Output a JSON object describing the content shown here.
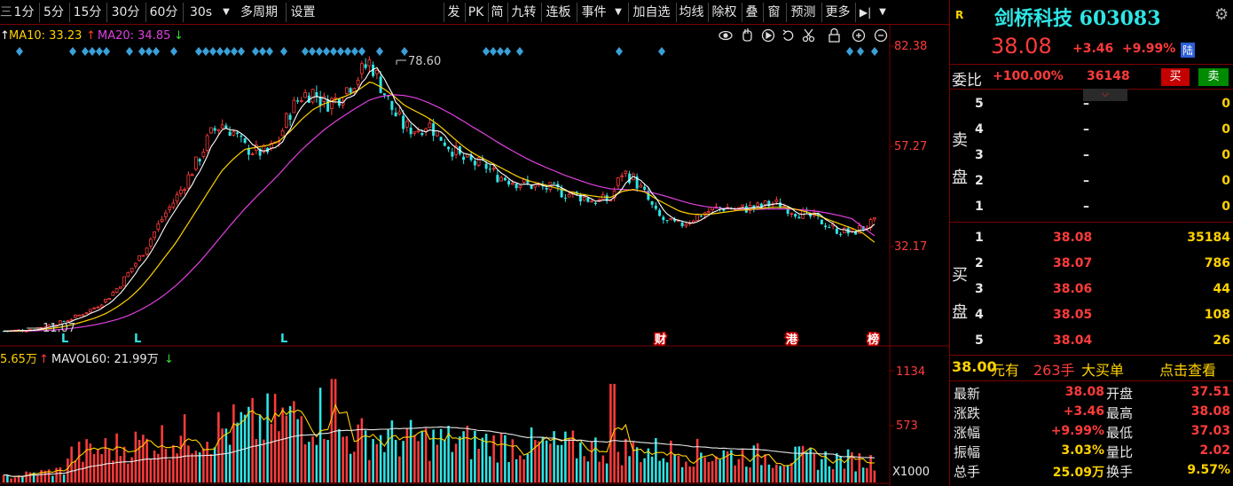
{
  "toolbar": {
    "items": [
      "1分",
      "5分",
      "15分",
      "30分",
      "60分",
      "30s",
      "多周期",
      "设置",
      "发",
      "PK",
      "简",
      "九转",
      "连板",
      "事件",
      "加自选",
      "均线",
      "除权",
      "叠",
      "窗",
      "预测",
      "更多"
    ]
  },
  "legend": {
    "ma10": "MA10: 33.23",
    "ma20": "MA20: 34.85",
    "vol": "5.65万",
    "mavol60": "MAVOL60: 21.99万"
  },
  "chart_labels": {
    "high_label": "78.60",
    "low_label": "11.07",
    "price_ticks": [
      "82.38",
      "57.27",
      "32.17"
    ],
    "vol_ticks": [
      "1134",
      "573"
    ],
    "vol_unit": "X1000",
    "markers": [
      "L",
      "L",
      "L",
      "财",
      "港",
      "榜"
    ]
  },
  "chart_data": {
    "type": "line",
    "price_axis_ticks": [
      82.38,
      57.27,
      32.17
    ],
    "volume_axis_ticks": [
      1134,
      573
    ],
    "close_series": [
      11.0,
      11.1,
      11.3,
      11.8,
      12.5,
      13.2,
      14.2,
      15.5,
      17.0,
      19.0,
      22.0,
      26.0,
      30.0,
      35.0,
      40.0,
      44.0,
      49.0,
      54.0,
      60.0,
      63.0,
      61.0,
      57.0,
      56.0,
      55.5,
      59.0,
      66.0,
      70.0,
      71.0,
      68.0,
      69.0,
      72.0,
      75.0,
      78.6,
      72.0,
      66.0,
      62.0,
      61.5,
      63.0,
      60.0,
      57.0,
      54.0,
      53.0,
      52.5,
      50.0,
      49.0,
      48.0,
      47.5,
      47.0,
      46.5,
      45.5,
      45.0,
      44.0,
      43.5,
      44.0,
      51.0,
      49.0,
      45.0,
      40.0,
      38.0,
      37.5,
      39.0,
      40.5,
      41.5,
      42.0,
      41.5,
      41.8,
      42.0,
      43.0,
      42.5,
      41.0,
      40.0,
      39.0,
      37.5,
      36.0,
      35.5,
      37.03,
      38.08
    ],
    "ma10": [
      11.0,
      11.0,
      11.1,
      11.3,
      11.6,
      12.0,
      12.6,
      13.4,
      14.3,
      15.5,
      17.2,
      19.3,
      22.0,
      25.5,
      29.3,
      33.0,
      37.5,
      42.0,
      46.5,
      51.0,
      54.0,
      56.5,
      57.0,
      57.5,
      58.5,
      61.0,
      64.0,
      66.5,
      68.0,
      69.0,
      70.0,
      71.5,
      73.5,
      72.0,
      70.0,
      67.5,
      66.0,
      64.5,
      62.5,
      60.0,
      57.5,
      55.5,
      54.0,
      52.5,
      51.0,
      49.5,
      48.5,
      47.8,
      47.0,
      46.2,
      45.5,
      45.0,
      44.6,
      44.5,
      46.0,
      46.5,
      45.8,
      44.0,
      42.5,
      41.0,
      40.3,
      40.2,
      40.4,
      40.8,
      41.2,
      41.4,
      41.7,
      42.0,
      42.0,
      41.6,
      40.9,
      40.0,
      38.9,
      37.8,
      36.8,
      35.5,
      33.23
    ],
    "ma20": [
      11.0,
      11.0,
      11.0,
      11.1,
      11.2,
      11.4,
      11.7,
      12.1,
      12.6,
      13.2,
      14.0,
      15.0,
      16.4,
      18.0,
      20.0,
      22.3,
      25.0,
      28.0,
      31.3,
      34.8,
      38.2,
      41.5,
      44.5,
      47.3,
      50.2,
      53.4,
      56.4,
      59.0,
      61.5,
      63.6,
      65.5,
      67.3,
      69.0,
      69.8,
      70.2,
      70.0,
      69.4,
      68.3,
      67.0,
      65.5,
      63.8,
      62.0,
      60.3,
      58.5,
      56.8,
      55.2,
      53.7,
      52.4,
      51.2,
      50.0,
      49.0,
      48.0,
      47.2,
      46.6,
      46.5,
      46.3,
      46.0,
      45.4,
      44.6,
      43.7,
      42.9,
      42.3,
      41.9,
      41.7,
      41.6,
      41.5,
      41.5,
      41.6,
      41.6,
      41.5,
      41.3,
      41.0,
      40.5,
      39.9,
      39.2,
      37.0,
      34.85
    ]
  },
  "panel": {
    "r_tag": "R",
    "name": "剑桥科技 603083",
    "price": "38.08",
    "change": "+3.46",
    "change_pct": "+9.99%",
    "market_tag": "陆",
    "weibi_label": "委比",
    "weibi_value": "+100.00%",
    "weibi_vol": "36148",
    "buy_btn": "买",
    "sell_btn": "卖",
    "sell_label": [
      "卖",
      "盘"
    ],
    "buy_label": [
      "买",
      "盘"
    ],
    "sell_book": [
      {
        "level": "5",
        "price": "–",
        "vol": "0"
      },
      {
        "level": "4",
        "price": "–",
        "vol": "0"
      },
      {
        "level": "3",
        "price": "–",
        "vol": "0"
      },
      {
        "level": "2",
        "price": "–",
        "vol": "0"
      },
      {
        "level": "1",
        "price": "–",
        "vol": "0"
      }
    ],
    "buy_book": [
      {
        "level": "1",
        "price": "38.08",
        "vol": "35184"
      },
      {
        "level": "2",
        "price": "38.07",
        "vol": "786"
      },
      {
        "level": "3",
        "price": "38.06",
        "vol": "44"
      },
      {
        "level": "4",
        "price": "38.05",
        "vol": "108"
      },
      {
        "level": "5",
        "price": "38.04",
        "vol": "26"
      }
    ],
    "bigorder": {
      "price": "38.00",
      "unit_text": "元有",
      "qty": "263手",
      "label": "大买单",
      "link": "点击查看"
    },
    "quote": [
      {
        "l1": "最新",
        "v1": "38.08",
        "l2": "开盘",
        "v2": "37.51"
      },
      {
        "l1": "涨跌",
        "v1": "+3.46",
        "l2": "最高",
        "v2": "38.08"
      },
      {
        "l1": "涨幅",
        "v1": "+9.99%",
        "l2": "最低",
        "v2": "37.03"
      },
      {
        "l1": "振幅",
        "v1": "3.03%",
        "l2": "量比",
        "v2": "2.02"
      },
      {
        "l1": "总手",
        "v1": "25.09万",
        "l2": "换手",
        "v2": "9.57%"
      }
    ],
    "colors": {
      "up": "#ff3b3b",
      "down": "#33dd33",
      "accent": "#2ee6e6",
      "ma10": "#ffd200",
      "ma20": "#e040e0"
    }
  }
}
